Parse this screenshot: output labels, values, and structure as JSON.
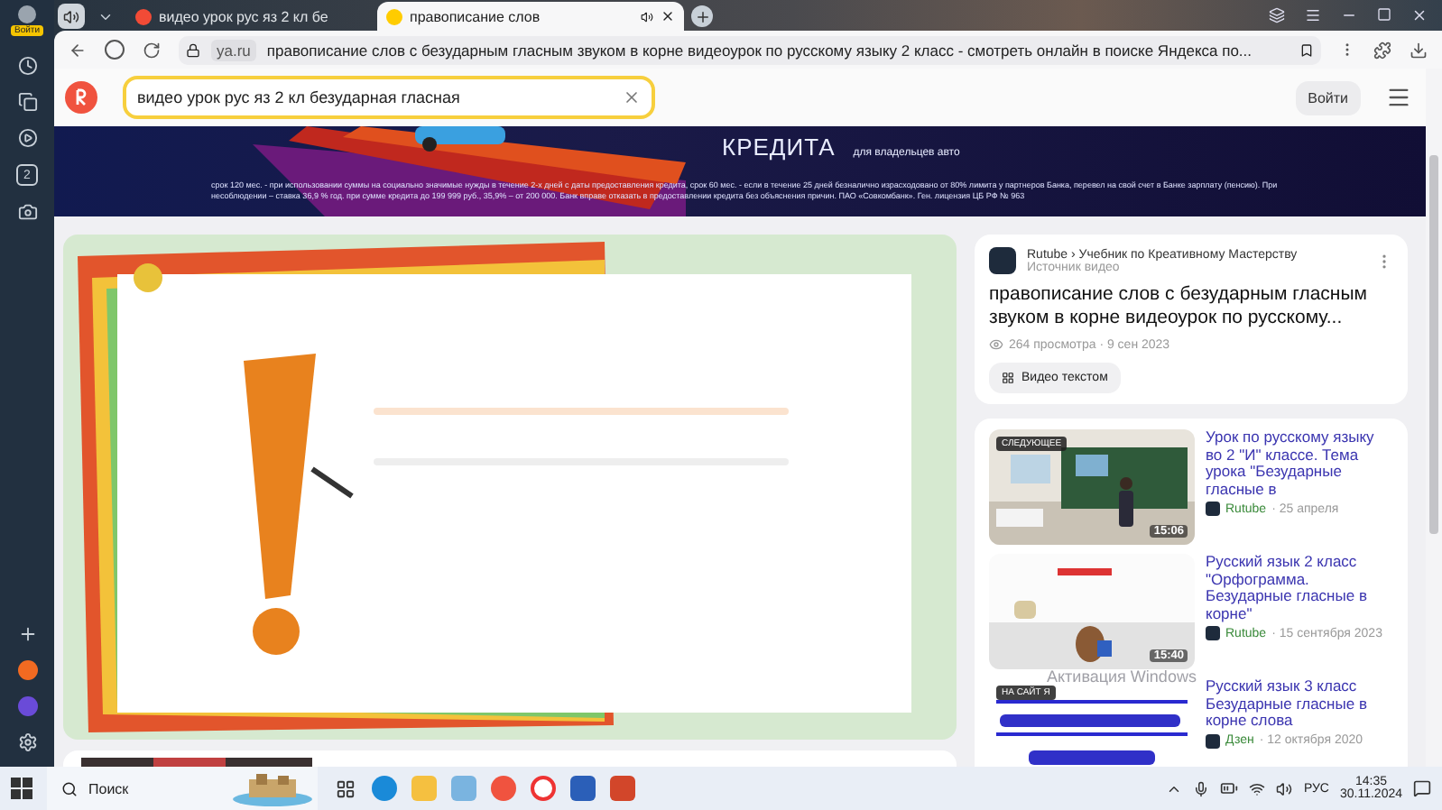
{
  "browser": {
    "sidebar": {
      "login_badge": "Войти",
      "counter": "2"
    },
    "tabs": [
      {
        "title": "видео урок рус яз 2 кл бе",
        "selected": false,
        "kind": "search"
      },
      {
        "title": "правописание слов",
        "selected": true,
        "kind": "video"
      }
    ],
    "address": {
      "domain": "ya.ru",
      "title": "правописание слов с безударным гласным звуком в корне видеоурок по русскому языку 2 класс - смотреть онлайн в поиске Яндекса по..."
    }
  },
  "header": {
    "query": "видео урок рус яз 2 кл безударная гласная",
    "login": "Войти"
  },
  "ad": {
    "headline": "КРЕДИТА",
    "subline": "для владельцев авто",
    "disclaimer": "срок 120 мес. - при использовании суммы на социально значимые нужды в течение 2-х дней с даты предоставления кредита, срок 60 мес. - если в течение 25 дней безналично израсходовано от 80% лимита у партнеров Банка, перевел на свой счет в Банке зарплату (пенсию). При несоблюдении – ставка 36,9 % год. при сумме кредита до 199 999 руб., 35,9% – от 200 000. Банк вправе отказать в предоставлении кредита без объяснения причин. ПАО «Совкомбанк». Ген. лицензия ЦБ РФ № 963"
  },
  "video_info": {
    "source": "Rutube › Учебник по Креативному Мастерству",
    "source_note": "Источник видео",
    "title": "правописание слов с безударным гласным звуком в корне видеоурок по русскому...",
    "meta": "264 просмотра · 9 сен 2023",
    "transcript_button": "Видео текстом"
  },
  "related": [
    {
      "title": "Урок по русскому языку во 2 \"И\" классе. Тема урока \"Безударные гласные в",
      "site": "Rutube",
      "date": "· 25 апреля",
      "duration": "15:06",
      "badge": "СЛЕДУЮЩЕЕ",
      "kind": "classroom"
    },
    {
      "title": "Русский язык 2 класс \"Орфограмма. Безударные гласные в корне\"",
      "site": "Rutube",
      "date": "· 15 сентября 2023",
      "duration": "15:40",
      "kind": "cartoon"
    },
    {
      "title": "Русский язык 3 класс Безударные гласные в корне слова",
      "site": "Дзен",
      "date": "· 12 октября 2020",
      "badge": "НА САЙТ Я",
      "kind": "lettering"
    }
  ],
  "os_notice": "Активация Windows",
  "taskbar": {
    "search": "Поиск",
    "language": "РУС",
    "time": "14:35",
    "date": "30.11.2024"
  }
}
